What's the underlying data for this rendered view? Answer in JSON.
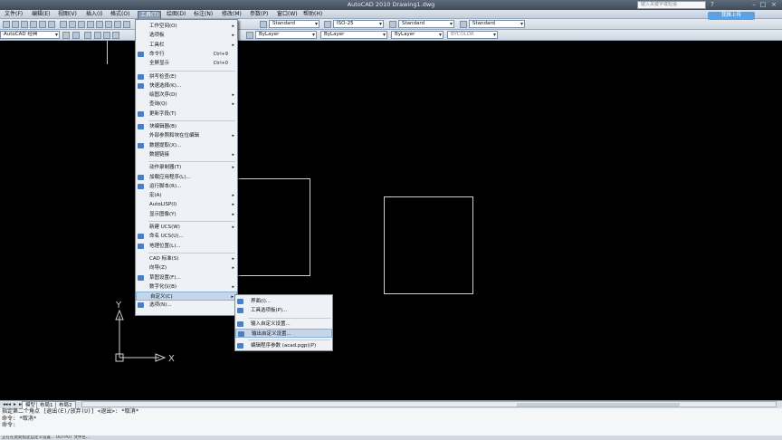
{
  "titlebar": {
    "title": "AutoCAD 2010    Drawing1.dwg",
    "search_placeholder": "键入关键字或短语",
    "upload_label": "我推上传"
  },
  "menubar": {
    "items": [
      "文件(F)",
      "编辑(E)",
      "视图(V)",
      "插入(I)",
      "格式(O)",
      "工具(T)",
      "绘图(D)",
      "标注(N)",
      "修改(M)",
      "参数(P)",
      "窗口(W)",
      "帮助(H)"
    ],
    "active": "工具(T)"
  },
  "toolbar": {
    "workspace": "AutoCAD 经典",
    "text_style": "Standard",
    "dim_style": "ISO-25",
    "table_style": "Standard",
    "mleader_style": "Standard",
    "color": "ByLayer",
    "linetype": "ByLayer",
    "lineweight": "ByLayer",
    "plotstyle": "BYCOLOR"
  },
  "tools_menu": {
    "items": [
      {
        "label": "工作空间(O)",
        "arrow": true
      },
      {
        "label": "选项板",
        "arrow": true
      },
      {
        "label": "工具栏",
        "arrow": true
      },
      {
        "label": "命令行",
        "shortcut": "Ctrl+9",
        "icon": "command-line-icon"
      },
      {
        "label": "全屏显示",
        "shortcut": "Ctrl+0"
      },
      {
        "sep": true
      },
      {
        "label": "拼写检查(E)",
        "icon": "spell-check-icon"
      },
      {
        "label": "快速选择(K)...",
        "icon": "quick-select-icon"
      },
      {
        "label": "绘图次序(D)",
        "arrow": true
      },
      {
        "label": "查询(Q)",
        "arrow": true
      },
      {
        "label": "更新字段(T)",
        "icon": "update-field-icon"
      },
      {
        "sep": true
      },
      {
        "label": "块编辑器(B)",
        "icon": "block-editor-icon"
      },
      {
        "label": "外部参照和块在位编辑",
        "arrow": true
      },
      {
        "label": "数据提取(X)...",
        "icon": "data-extract-icon"
      },
      {
        "label": "数据链接",
        "arrow": true
      },
      {
        "sep": true
      },
      {
        "label": "动作录制器(T)",
        "arrow": true
      },
      {
        "label": "加载应用程序(L)...",
        "icon": "load-app-icon"
      },
      {
        "label": "运行脚本(R)...",
        "icon": "run-script-icon"
      },
      {
        "label": "宏(A)",
        "arrow": true
      },
      {
        "label": "AutoLISP(I)",
        "arrow": true
      },
      {
        "label": "显示图像(Y)",
        "arrow": true
      },
      {
        "sep": true
      },
      {
        "label": "新建 UCS(W)",
        "arrow": true
      },
      {
        "label": "命名 UCS(U)...",
        "icon": "named-ucs-icon"
      },
      {
        "label": "地理位置(L)...",
        "icon": "geo-location-icon"
      },
      {
        "sep": true
      },
      {
        "label": "CAD 标准(S)",
        "arrow": true
      },
      {
        "label": "向导(Z)",
        "arrow": true
      },
      {
        "label": "草图设置(F)...",
        "icon": "drafting-settings-icon"
      },
      {
        "label": "数字化仪(B)",
        "arrow": true
      },
      {
        "label": "自定义(C)",
        "arrow": true,
        "highlight": true
      },
      {
        "label": "选项(N)...",
        "icon": "options-icon"
      }
    ]
  },
  "customize_submenu": {
    "items": [
      {
        "label": "界面(I)...",
        "icon": "interface-icon"
      },
      {
        "label": "工具选项板(P)...",
        "icon": "tool-palette-icon"
      },
      {
        "sep": true
      },
      {
        "label": "输入自定义设置...",
        "icon": "import-customization-icon"
      },
      {
        "label": "输出自定义设置...",
        "icon": "export-customization-icon",
        "highlight": true
      },
      {
        "sep": true
      },
      {
        "label": "编辑程序参数 (acad.pgp)(P)",
        "icon": "edit-pgp-icon"
      }
    ]
  },
  "layout_tabs": [
    "模型",
    "布局1",
    "布局2"
  ],
  "ucs": {
    "x_label": "X",
    "y_label": "Y"
  },
  "command": {
    "lines": [
      "指定第二个角点 [退出(E)/放弃(U)] <退出>: *取消*",
      "命令: *取消*",
      "命令:"
    ]
  },
  "statusbar": {
    "text": "正在在此处指定自定义设置...   OUTPUT   文件名..."
  },
  "colors": {
    "canvas": "#000000",
    "menu_bg": "#eef1f5",
    "highlight": "#c5d6ea",
    "title_bar": "#4b5766",
    "upload_button": "#5aa2e8"
  }
}
